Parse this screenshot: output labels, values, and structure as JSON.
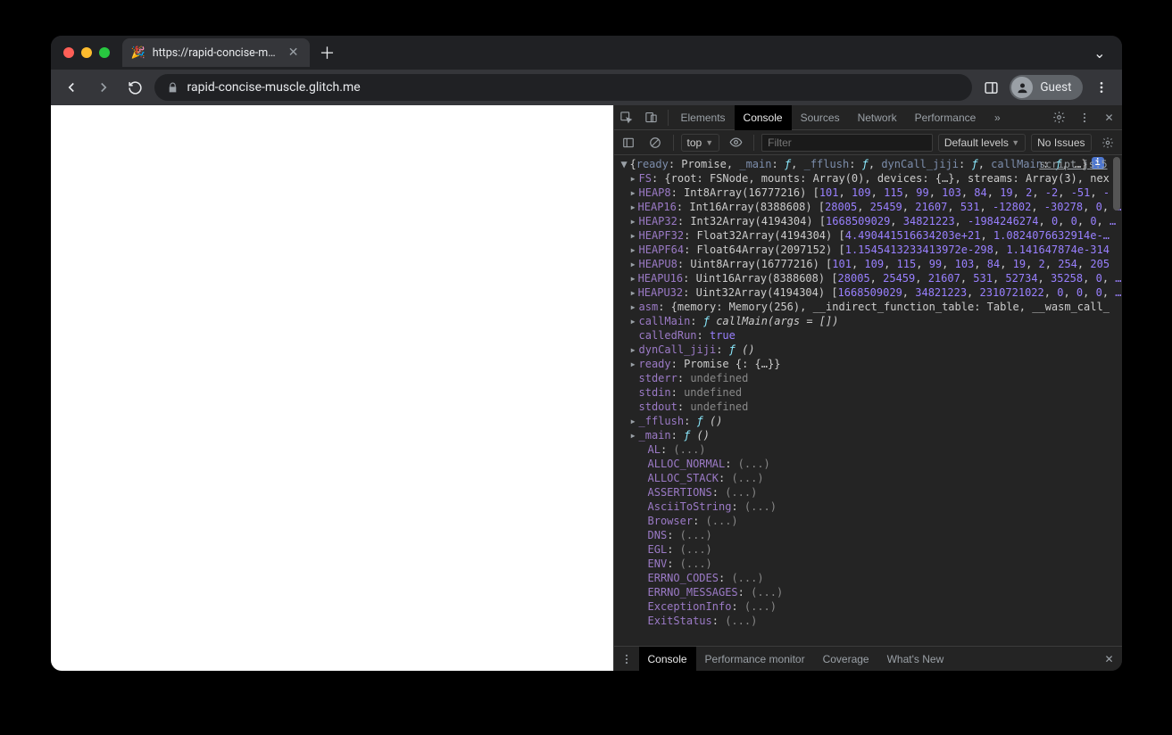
{
  "browser": {
    "tab_title": "https://rapid-concise-muscle.g",
    "url_display": "rapid-concise-muscle.glitch.me",
    "guest_label": "Guest"
  },
  "devtools": {
    "tabs": [
      "Elements",
      "Console",
      "Sources",
      "Network",
      "Performance"
    ],
    "active_tab": "Console",
    "console_toolbar": {
      "context": "top",
      "filter_placeholder": "Filter",
      "levels": "Default levels",
      "issues": "No Issues"
    },
    "source_link": "script.js:5",
    "drawer_tabs": [
      "Console",
      "Performance monitor",
      "Coverage",
      "What's New"
    ],
    "drawer_active": "Console"
  },
  "console_object": {
    "summary": "{ready: Promise, _main: ƒ, _fflush: ƒ, dynCall_jiji: ƒ, callMain: ƒ, …}",
    "props": [
      {
        "k": "FS",
        "v": "{root: FSNode, mounts: Array(0), devices: {…}, streams: Array(3), nex",
        "arrow": true
      },
      {
        "k": "HEAP8",
        "type": "Int8Array(16777216)",
        "nums": [
          "101",
          "109",
          "115",
          "99",
          "103",
          "84",
          "19",
          "2",
          "-2",
          "-51",
          "-"
        ],
        "arrow": true
      },
      {
        "k": "HEAP16",
        "type": "Int16Array(8388608)",
        "nums": [
          "28005",
          "25459",
          "21607",
          "531",
          "-12802",
          "-30278",
          "0",
          "…"
        ],
        "arrow": true
      },
      {
        "k": "HEAP32",
        "type": "Int32Array(4194304)",
        "nums": [
          "1668509029",
          "34821223",
          "-1984246274",
          "0",
          "0",
          "0",
          "…"
        ],
        "arrow": true
      },
      {
        "k": "HEAPF32",
        "type": "Float32Array(4194304)",
        "nums": [
          "4.490441516634203e+21",
          "1.0824076632914e-…"
        ],
        "arrow": true
      },
      {
        "k": "HEAPF64",
        "type": "Float64Array(2097152)",
        "nums": [
          "1.1545413233413972e-298",
          "1.141647874e-314"
        ],
        "arrow": true
      },
      {
        "k": "HEAPU8",
        "type": "Uint8Array(16777216)",
        "nums": [
          "101",
          "109",
          "115",
          "99",
          "103",
          "84",
          "19",
          "2",
          "254",
          "205"
        ],
        "arrow": true
      },
      {
        "k": "HEAPU16",
        "type": "Uint16Array(8388608)",
        "nums": [
          "28005",
          "25459",
          "21607",
          "531",
          "52734",
          "35258",
          "0",
          "…"
        ],
        "arrow": true
      },
      {
        "k": "HEAPU32",
        "type": "Uint32Array(4194304)",
        "nums": [
          "1668509029",
          "34821223",
          "2310721022",
          "0",
          "0",
          "0",
          "…"
        ],
        "arrow": true
      },
      {
        "k": "asm",
        "v": "{memory: Memory(256), __indirect_function_table: Table, __wasm_call_",
        "arrow": true
      },
      {
        "k": "callMain",
        "func": "callMain(args = [])",
        "arrow": true
      },
      {
        "k": "calledRun",
        "bool": "true"
      },
      {
        "k": "dynCall_jiji",
        "func": "()",
        "arrow": true
      },
      {
        "k": "ready",
        "v": "Promise {<fulfilled>: {…}}",
        "arrow": true
      },
      {
        "k": "stderr",
        "dim": "undefined"
      },
      {
        "k": "stdin",
        "dim": "undefined"
      },
      {
        "k": "stdout",
        "dim": "undefined"
      },
      {
        "k": "_fflush",
        "func": "()",
        "arrow": true
      },
      {
        "k": "_main",
        "func": "()",
        "arrow": true
      }
    ],
    "lazy": [
      "AL",
      "ALLOC_NORMAL",
      "ALLOC_STACK",
      "ASSERTIONS",
      "AsciiToString",
      "Browser",
      "DNS",
      "EGL",
      "ENV",
      "ERRNO_CODES",
      "ERRNO_MESSAGES",
      "ExceptionInfo",
      "ExitStatus"
    ]
  }
}
